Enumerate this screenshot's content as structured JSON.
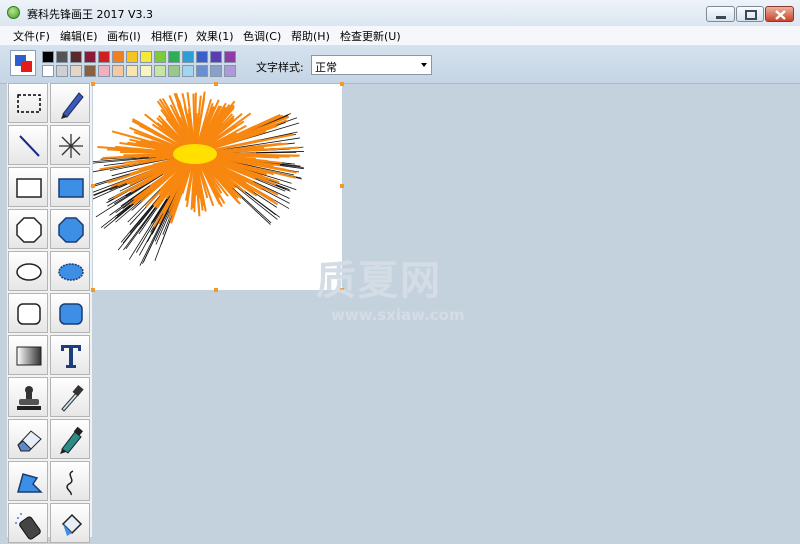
{
  "window": {
    "title": "赛科先锋画王 2017 V3.3"
  },
  "menu": [
    {
      "label": "文件(F)"
    },
    {
      "label": "编辑(E)"
    },
    {
      "label": "画布(I)"
    },
    {
      "label": "相框(F)"
    },
    {
      "label": "效果(1)"
    },
    {
      "label": "色调(C)"
    },
    {
      "label": "帮助(H)"
    },
    {
      "label": "检查更新(U)"
    }
  ],
  "colors": {
    "foreground": "#2f5fcf",
    "background": "#e21b1b",
    "palette_top": [
      "#000000",
      "#555555",
      "#5a2a2a",
      "#8b1a3a",
      "#d01f1f",
      "#ef7f1f",
      "#f6c321",
      "#f4ea3a",
      "#7dcb3b",
      "#2fae55",
      "#2e9fd6",
      "#3a5fc8",
      "#5a3db0",
      "#8f3da4"
    ],
    "palette_bottom": [
      "#ffffff",
      "#cfcfcf",
      "#e6d6c6",
      "#8a6040",
      "#f0b0c0",
      "#f4c8a0",
      "#f8e6b0",
      "#f6f4c0",
      "#c8e6a0",
      "#9ac888",
      "#a0d6ee",
      "#6a8fd0",
      "#8aa0c6",
      "#b09ad6"
    ]
  },
  "text_style": {
    "label": "文字样式:",
    "value": "正常"
  },
  "tools": [
    {
      "name": "rect-select-tool"
    },
    {
      "name": "pen-tool"
    },
    {
      "name": "line-tool"
    },
    {
      "name": "spray-lines-tool"
    },
    {
      "name": "rectangle-tool"
    },
    {
      "name": "filled-rectangle-tool"
    },
    {
      "name": "octagon-tool"
    },
    {
      "name": "filled-octagon-tool"
    },
    {
      "name": "ellipse-tool"
    },
    {
      "name": "filled-ellipse-tool"
    },
    {
      "name": "rounded-rect-tool"
    },
    {
      "name": "filled-rounded-rect-tool"
    },
    {
      "name": "gradient-tool"
    },
    {
      "name": "text-tool"
    },
    {
      "name": "stamp-tool"
    },
    {
      "name": "eyedropper-tool"
    },
    {
      "name": "eraser-tool"
    },
    {
      "name": "marker-tool"
    },
    {
      "name": "polygon-tool"
    },
    {
      "name": "curve-tool"
    },
    {
      "name": "spray-can-tool"
    },
    {
      "name": "fill-bucket-tool"
    }
  ],
  "watermark": {
    "text": "质夏网",
    "url": "www.sxiaw.com"
  }
}
